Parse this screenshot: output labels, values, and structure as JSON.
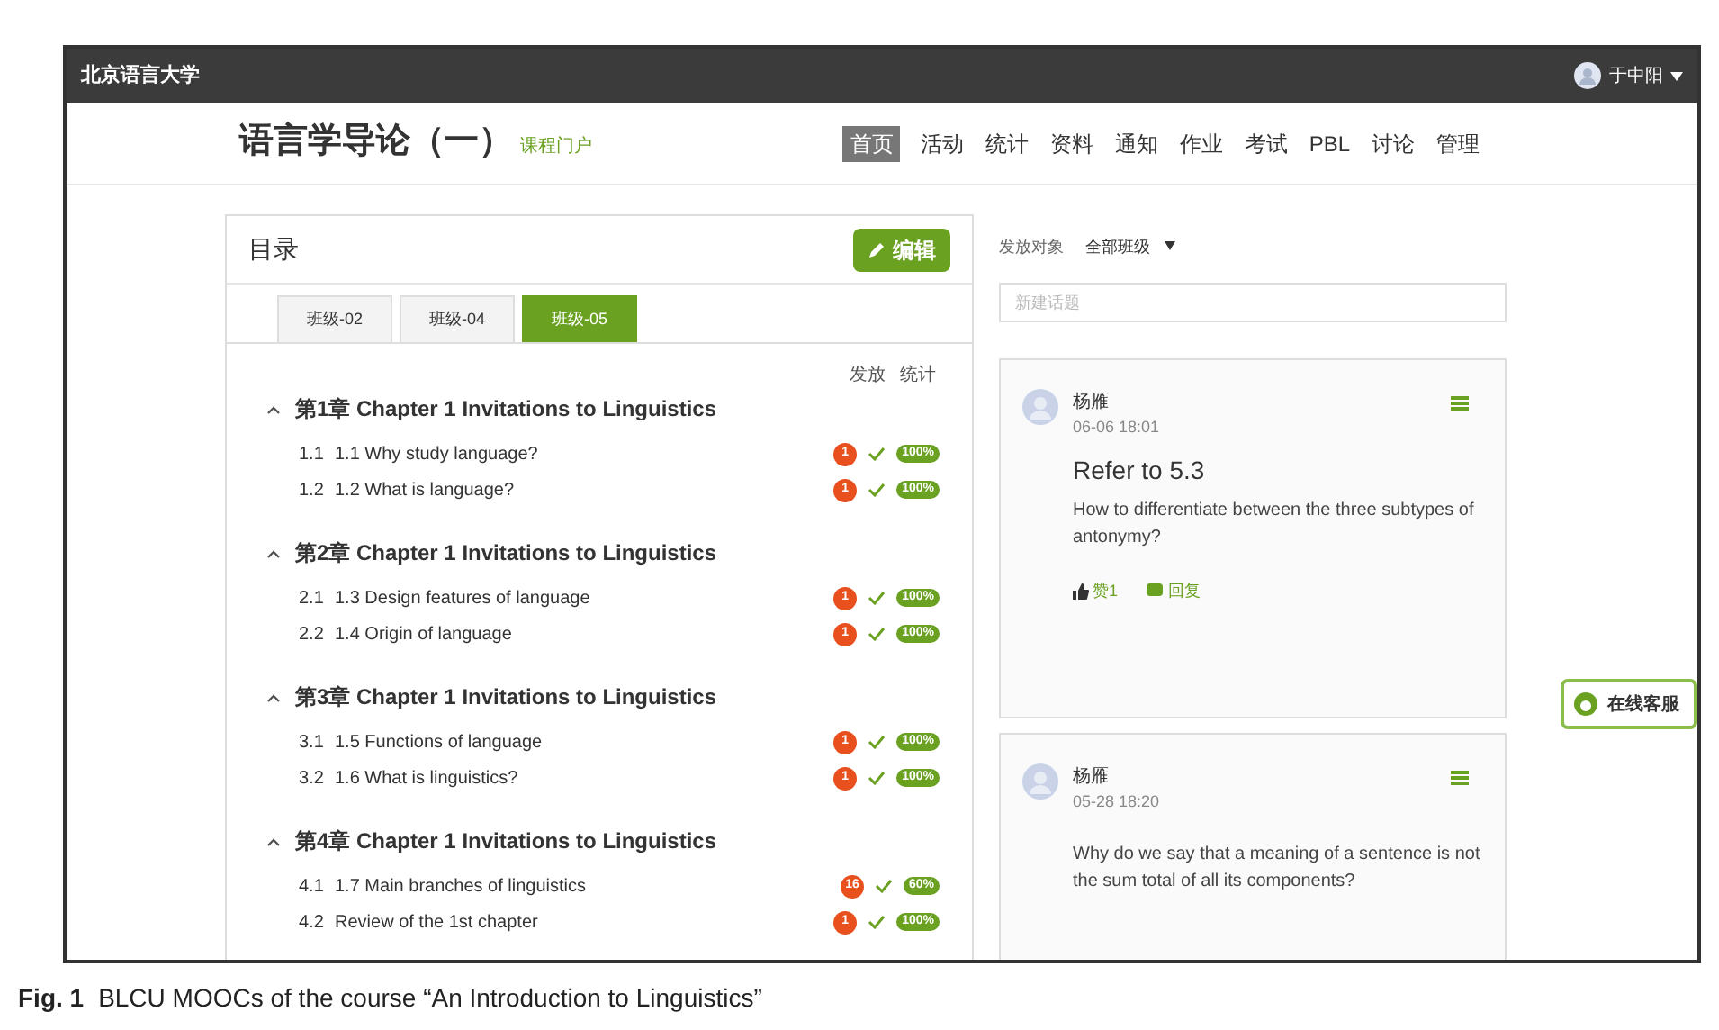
{
  "topbar": {
    "site": "北京语言大学",
    "user": "于中阳"
  },
  "header": {
    "title": "语言学导论（一）",
    "portal_link": "课程门户",
    "nav": [
      {
        "label": "首页",
        "selected": true
      },
      {
        "label": "活动",
        "selected": false
      },
      {
        "label": "统计",
        "selected": false
      },
      {
        "label": "资料",
        "selected": false
      },
      {
        "label": "通知",
        "selected": false
      },
      {
        "label": "作业",
        "selected": false
      },
      {
        "label": "考试",
        "selected": false
      },
      {
        "label": "PBL",
        "selected": false
      },
      {
        "label": "讨论",
        "selected": false
      },
      {
        "label": "管理",
        "selected": false
      }
    ]
  },
  "catalog": {
    "title": "目录",
    "edit_button": "编辑",
    "tabs": [
      {
        "label": "班级-02",
        "selected": false
      },
      {
        "label": "班级-04",
        "selected": false
      },
      {
        "label": "班级-05",
        "selected": true
      }
    ],
    "column_labels": [
      "发放",
      "统计"
    ],
    "chapters": [
      {
        "title": "第1章 Chapter 1 Invitations to Linguistics",
        "expanded": true,
        "children": [
          {
            "number": "1.1",
            "title": "1.1 Why study language?",
            "count": "1",
            "checked": true,
            "progress": "100%"
          },
          {
            "number": "1.2",
            "title": "1.2 What is language?",
            "count": "1",
            "checked": true,
            "progress": "100%"
          }
        ]
      },
      {
        "title": "第2章 Chapter 1 Invitations to Linguistics",
        "expanded": true,
        "children": [
          {
            "number": "2.1",
            "title": "1.3 Design features of language",
            "count": "1",
            "checked": true,
            "progress": "100%"
          },
          {
            "number": "2.2",
            "title": "1.4 Origin of language",
            "count": "1",
            "checked": true,
            "progress": "100%"
          }
        ]
      },
      {
        "title": "第3章 Chapter 1 Invitations to Linguistics",
        "expanded": true,
        "children": [
          {
            "number": "3.1",
            "title": "1.5 Functions of language",
            "count": "1",
            "checked": true,
            "progress": "100%"
          },
          {
            "number": "3.2",
            "title": "1.6 What is linguistics?",
            "count": "1",
            "checked": true,
            "progress": "100%"
          }
        ]
      },
      {
        "title": "第4章 Chapter 1 Invitations to Linguistics",
        "expanded": true,
        "children": [
          {
            "number": "4.1",
            "title": "1.7 Main branches of linguistics",
            "count": "16",
            "checked": true,
            "progress": "60%"
          },
          {
            "number": "4.2",
            "title": "Review of the 1st chapter",
            "count": "1",
            "checked": true,
            "progress": "100%"
          }
        ]
      }
    ]
  },
  "discussion": {
    "audience_label": "发放对象",
    "audience_value": "全部班级",
    "new_topic": {
      "placeholder": "新建话题"
    },
    "posts": [
      {
        "author": "杨雁",
        "time": "06-06 18:01",
        "title": "Refer to 5.3",
        "body": "How to differentiate between the three subtypes of antonymy?",
        "like": "赞1",
        "reply": "回复"
      },
      {
        "author": "杨雁",
        "time": "05-28 18:20",
        "body": "Why do we say that a meaning of a sentence is not the sum total of all its components?"
      }
    ]
  },
  "support_button": "在线客服",
  "caption": {
    "label": "Fig. 1",
    "text": "BLCU MOOCs of the course “An Introduction to Linguistics”"
  }
}
